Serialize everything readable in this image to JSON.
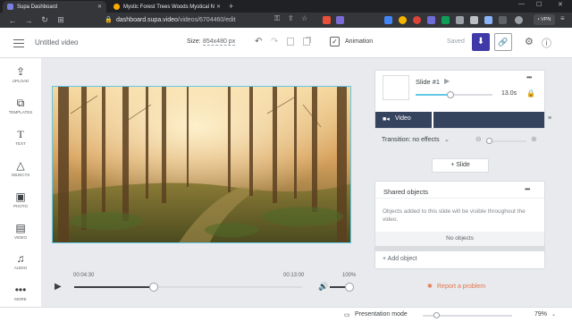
{
  "browser": {
    "tabs": [
      {
        "title": "Supa Dashboard",
        "active": true
      },
      {
        "title": "Mystic Forest Trees Woods Mystical N",
        "active": false
      }
    ],
    "url": {
      "host": "dashboard.supa.video",
      "path": "/videos/6704460/edit"
    },
    "vpn_label": "• VPN"
  },
  "header": {
    "title": "Untitled video",
    "size_label": "Size:",
    "size_value": "854x480 px",
    "animation_label": "Animation",
    "saved_label": "Saved"
  },
  "sidebar": {
    "items": [
      {
        "label": "UPLOAD",
        "icon": "upload-icon"
      },
      {
        "label": "TEMPLATES",
        "icon": "templates-icon"
      },
      {
        "label": "TEXT",
        "icon": "text-icon"
      },
      {
        "label": "OBJECTS",
        "icon": "objects-icon"
      },
      {
        "label": "PHOTO",
        "icon": "photo-icon"
      },
      {
        "label": "VIDEO",
        "icon": "video-icon"
      },
      {
        "label": "AUDIO",
        "icon": "audio-icon"
      },
      {
        "label": "MORE",
        "icon": "more-icon"
      }
    ]
  },
  "slide": {
    "name": "Slide #1",
    "duration": "13.0s",
    "duration_progress": 0.45,
    "layer_label": "Video",
    "transition_label": "Transition: no effects",
    "add_slide_label": "+ Slide"
  },
  "shared": {
    "title": "Shared objects",
    "description": "Objects added to this slide will be visible throughout the video.",
    "empty_label": "No objects",
    "add_label": "+ Add object"
  },
  "timeline": {
    "current_time": "00:04:30",
    "total_time": "00:13:00",
    "progress": 0.35,
    "volume_label": "100%",
    "volume": 1.0
  },
  "report_label": "Report a problem",
  "bottom": {
    "presentation_label": "Presentation mode",
    "zoom": "79%"
  },
  "colors": {
    "accent": "#3f3aa8",
    "canvas_border": "#63c7e6",
    "layer_bar": "#35435e",
    "report": "#e8734a"
  }
}
